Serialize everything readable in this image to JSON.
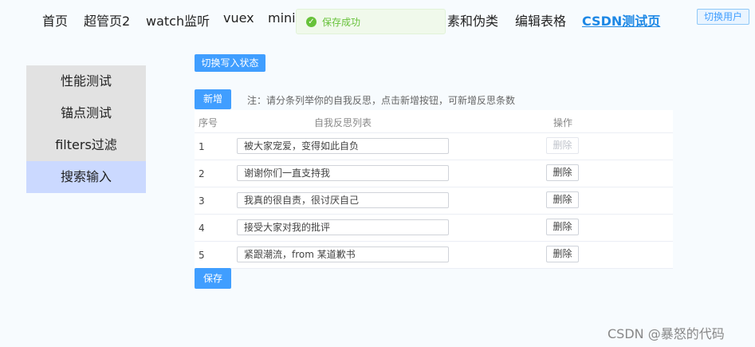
{
  "nav": {
    "items": [
      {
        "label": "首页",
        "active": false
      },
      {
        "label": "超管页2",
        "active": false
      },
      {
        "label": "watch监听",
        "active": false
      },
      {
        "label": "vuex",
        "active": false
      },
      {
        "label": "minix",
        "active": false
      },
      {
        "label": "素和伪类",
        "active": false
      },
      {
        "label": "编辑表格",
        "active": false
      },
      {
        "label": "CSDN测试页",
        "active": true
      }
    ],
    "switch_user": "切换用户"
  },
  "toast": {
    "message": "保存成功",
    "icon": "check-circle-icon",
    "color": "#67c23a"
  },
  "sidebar": {
    "items": [
      {
        "label": "性能测试",
        "active": false
      },
      {
        "label": "锚点测试",
        "active": false
      },
      {
        "label": "filters过滤",
        "active": false
      },
      {
        "label": "搜索输入",
        "active": true
      }
    ]
  },
  "main": {
    "toggle_write_label": "切换写入状态",
    "add_label": "新增",
    "note": "注：请分条列举你的自我反思，点击新增按钮，可新增反思条数",
    "save_label": "保存",
    "table": {
      "headers": {
        "index": "序号",
        "list": "自我反思列表",
        "action": "操作"
      },
      "rows": [
        {
          "index": "1",
          "text": "被大家宠爱，变得如此自负",
          "action": "删除",
          "disabled": true
        },
        {
          "index": "2",
          "text": "谢谢你们一直支持我",
          "action": "删除",
          "disabled": false
        },
        {
          "index": "3",
          "text": "我真的很自责，很讨厌自己",
          "action": "删除",
          "disabled": false
        },
        {
          "index": "4",
          "text": "接受大家对我的批评",
          "action": "删除",
          "disabled": false
        },
        {
          "index": "5",
          "text": "紧跟潮流，from 某道歉书",
          "action": "删除",
          "disabled": false
        }
      ]
    }
  },
  "watermark": "CSDN @暴怒的代码",
  "colors": {
    "accent": "#409eff",
    "active_nav": "#1e88e5",
    "sidebar_active": "#cbd9ff"
  }
}
